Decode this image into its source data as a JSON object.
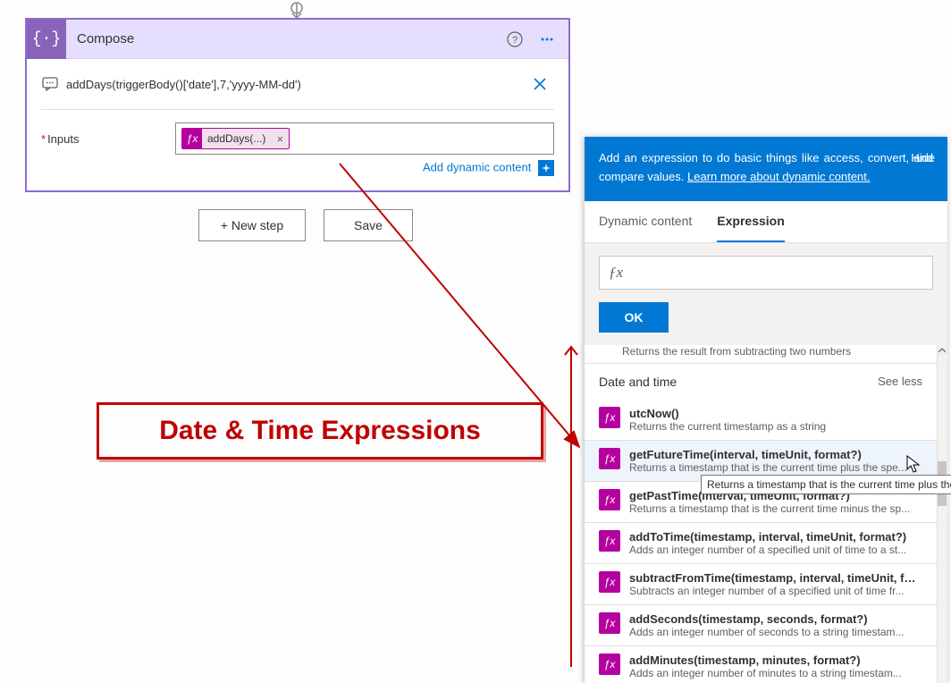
{
  "flow": {
    "compose": {
      "title": "Compose",
      "expression": "addDays(triggerBody()['date'],7,'yyyy-MM-dd')",
      "inputs_label": "Inputs",
      "token_label": "addDays(...)",
      "add_dynamic_label": "Add dynamic content"
    },
    "buttons": {
      "new_step": "+ New step",
      "save": "Save"
    }
  },
  "annotation": {
    "text": "Date & Time Expressions"
  },
  "panel": {
    "help_text_1": "Add an expression to do basic things like access, convert, and compare values. ",
    "help_link": "Learn more about dynamic content.",
    "hide": "Hide",
    "tabs": {
      "dynamic": "Dynamic content",
      "expression": "Expression"
    },
    "ok": "OK",
    "prev_desc": "Returns the result from subtracting two numbers",
    "section": {
      "title": "Date and time",
      "see_less": "See less"
    },
    "functions": [
      {
        "name": "utcNow()",
        "desc": "Returns the current timestamp as a string"
      },
      {
        "name": "getFutureTime(interval, timeUnit, format?)",
        "desc": "Returns a timestamp that is the current time plus the spe..."
      },
      {
        "name": "getPastTime(interval, timeUnit, format?)",
        "desc": "Returns a timestamp that is the current time minus the sp..."
      },
      {
        "name": "addToTime(timestamp, interval, timeUnit, format?)",
        "desc": "Adds an integer number of a specified unit of time to a st..."
      },
      {
        "name": "subtractFromTime(timestamp, interval, timeUnit, forma...",
        "desc": "Subtracts an integer number of a specified unit of time fr..."
      },
      {
        "name": "addSeconds(timestamp, seconds, format?)",
        "desc": "Adds an integer number of seconds to a string timestam..."
      },
      {
        "name": "addMinutes(timestamp, minutes, format?)",
        "desc": "Adds an integer number of minutes to a string timestam..."
      }
    ],
    "tooltip": "Returns a timestamp that is the current time plus the"
  }
}
